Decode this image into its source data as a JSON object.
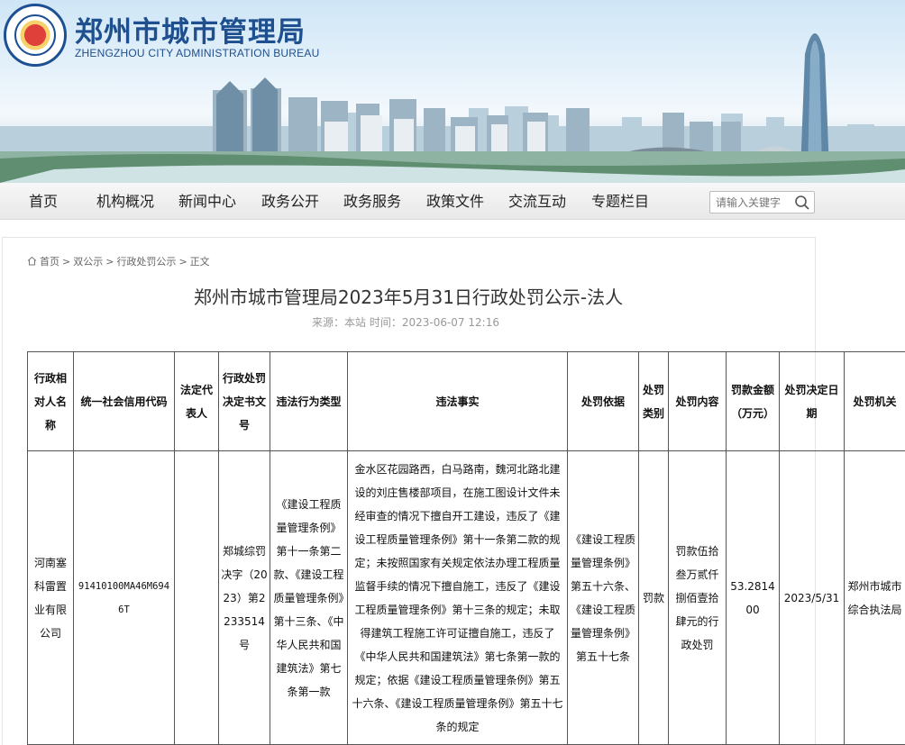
{
  "header": {
    "site_title": "郑州市城市管理局",
    "site_subtitle": "ZHENGZHOU CITY ADMINISTRATION BUREAU"
  },
  "nav": {
    "items": [
      "首页",
      "机构概况",
      "新闻中心",
      "政务公开",
      "政务服务",
      "政策文件",
      "交流互动",
      "专题栏目"
    ],
    "search_placeholder": "请输入关键字"
  },
  "breadcrumb": [
    "首页",
    "双公示",
    "行政处罚公示",
    "正文"
  ],
  "article": {
    "title": "郑州市城市管理局2023年5月31日行政处罚公示-法人",
    "meta": "来源：本站  时间：2023-06-07 12:16"
  },
  "table": {
    "headers": [
      "行政相对人名称",
      "统一社会信用代码",
      "法定代表人",
      "行政处罚决定书文号",
      "违法行为类型",
      "违法事实",
      "处罚依据",
      "处罚类别",
      "处罚内容",
      "罚款金额（万元）",
      "处罚决定日期",
      "处罚机关"
    ],
    "rows": [
      [
        "河南塞科雷置业有限公司",
        "91410100MA46M6946T",
        "",
        "郑城综罚决字（2023）第2233514号",
        "《建设工程质量管理条例》第十一条第二款、《建设工程质量管理条例》第十三条、《中华人民共和国建筑法》第七条第一款",
        "金水区花园路西，白马路南，魏河北路北建设的刘庄售楼部项目，在施工图设计文件未经审查的情况下擅自开工建设，违反了《建设工程质量管理条例》第十一条第二款的规定；未按照国家有关规定依法办理工程质量监督手续的情况下擅自施工，违反了《建设工程质量管理条例》第十三条的规定；未取得建筑工程施工许可证擅自施工，违反了《中华人民共和国建筑法》第七条第一款的规定；依据《建设工程质量管理条例》第五十六条、《建设工程质量管理条例》第五十七条的规定",
        "《建设工程质量管理条例》第五十六条、《建设工程质量管理条例》第五十七条",
        "罚款",
        "罚款伍拾叁万贰仟捌佰壹拾肆元的行政处罚",
        "53.281400",
        "2023/5/31",
        "郑州市城市综合执法局"
      ]
    ]
  },
  "colors": {
    "brand_blue": "#1e4f8e",
    "nav_bg": "#ececec"
  }
}
